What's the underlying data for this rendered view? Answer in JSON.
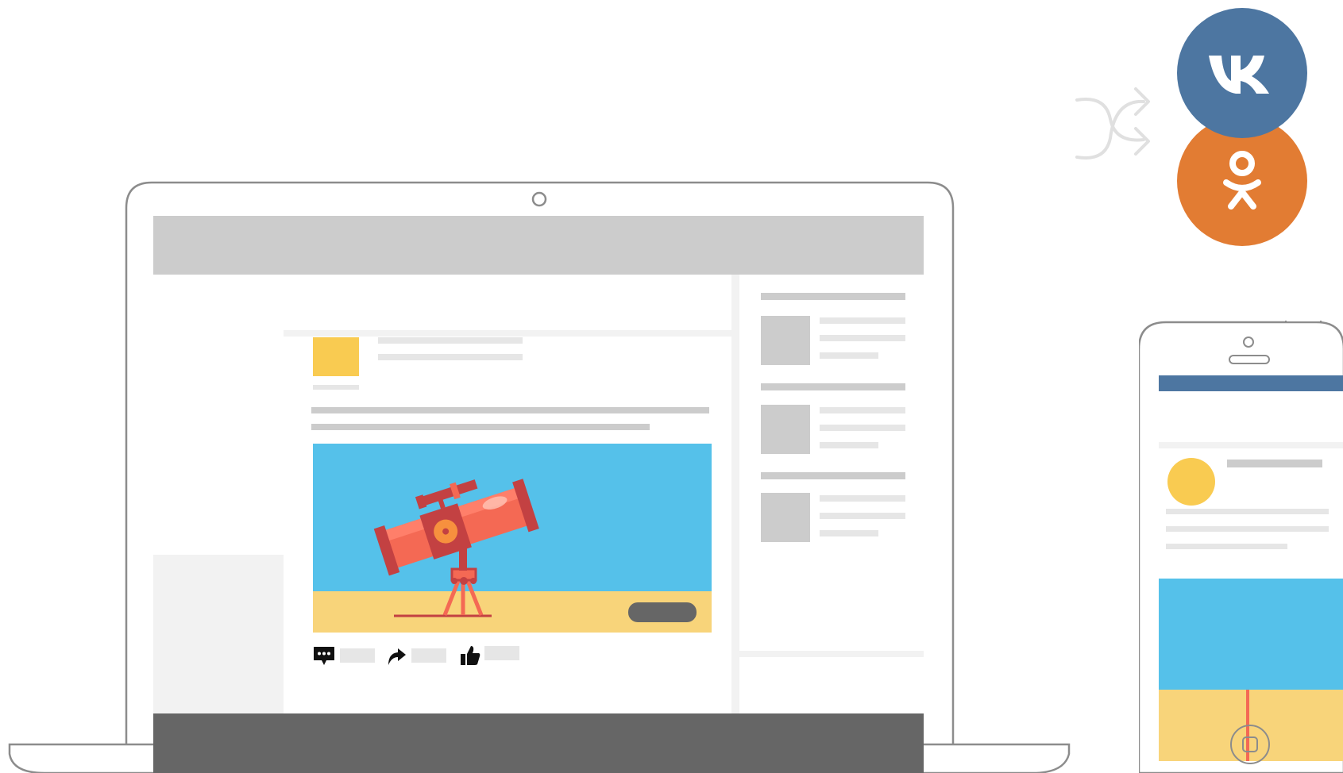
{
  "colors": {
    "vk": "#4d76a1",
    "ok": "#e27c33",
    "sky": "#55c1ea",
    "sand": "#f8d47a",
    "avatar": "#f9cb51",
    "chrome_gray": "#cccccc",
    "base_gray": "#666666",
    "telescope": "#f46954",
    "telescope_dark": "#c34142",
    "telescope_accent": "#f7903e"
  },
  "icons": {
    "vk": "vk-logo-icon",
    "ok": "odnoklassniki-logo-icon",
    "shuffle": "shuffle-arrows-icon",
    "comment": "comment-icon",
    "share": "share-icon",
    "like": "thumbs-up-icon"
  }
}
